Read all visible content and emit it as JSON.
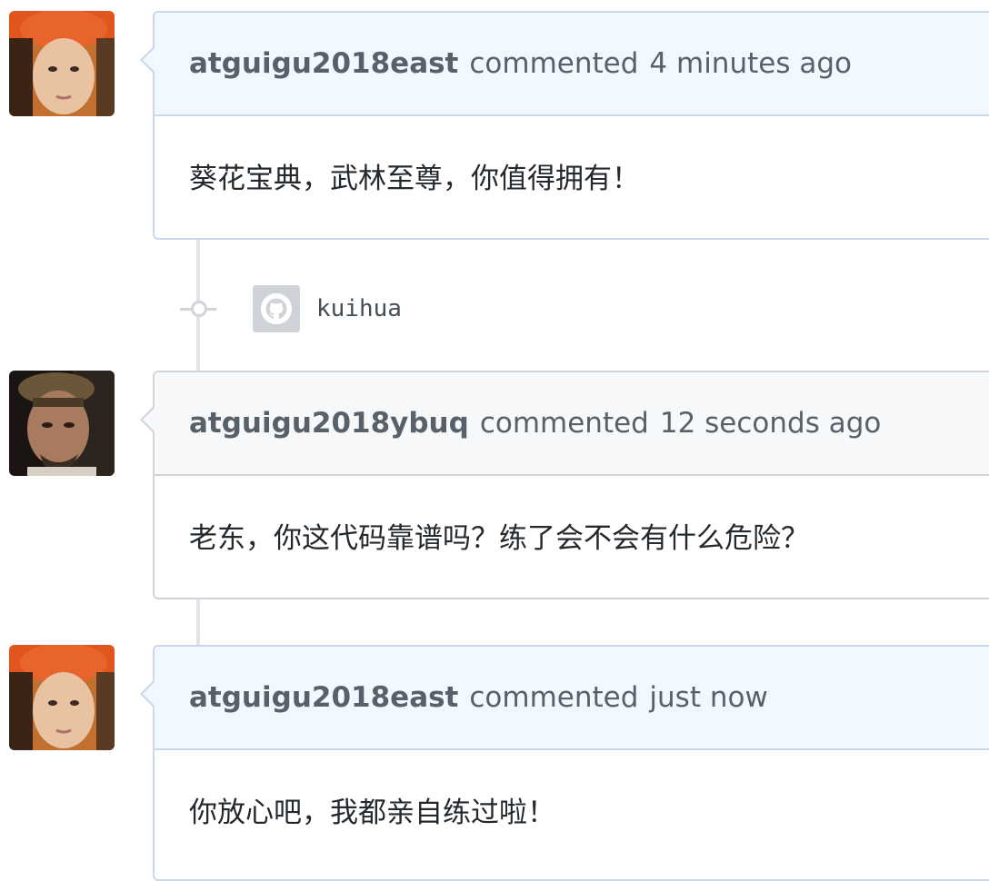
{
  "comments": [
    {
      "author": "atguigu2018east",
      "action": "commented",
      "time": "4 minutes ago",
      "body": "葵花宝典，武林至尊，你值得拥有！",
      "avatar": "avatar-east-icon",
      "header_color": "#f1f8ff"
    },
    {
      "author": "atguigu2018ybuq",
      "action": "commented",
      "time": "12 seconds ago",
      "body": "老东，你这代码靠谱吗？练了会不会有什么危险？",
      "avatar": "avatar-ybuq-icon",
      "header_color": "#f6f8fa"
    },
    {
      "author": "atguigu2018east",
      "action": "commented",
      "time": "just now",
      "body": "你放心吧，我都亲自练过啦！",
      "avatar": "avatar-east-icon",
      "header_color": "#f1f8ff"
    }
  ],
  "event": {
    "label": "kuihua",
    "icon": "github-icon"
  },
  "colors": {
    "border_blue": "#c9d8ea",
    "border_gray": "#d1d5da",
    "timeline": "#e1e4e8"
  }
}
